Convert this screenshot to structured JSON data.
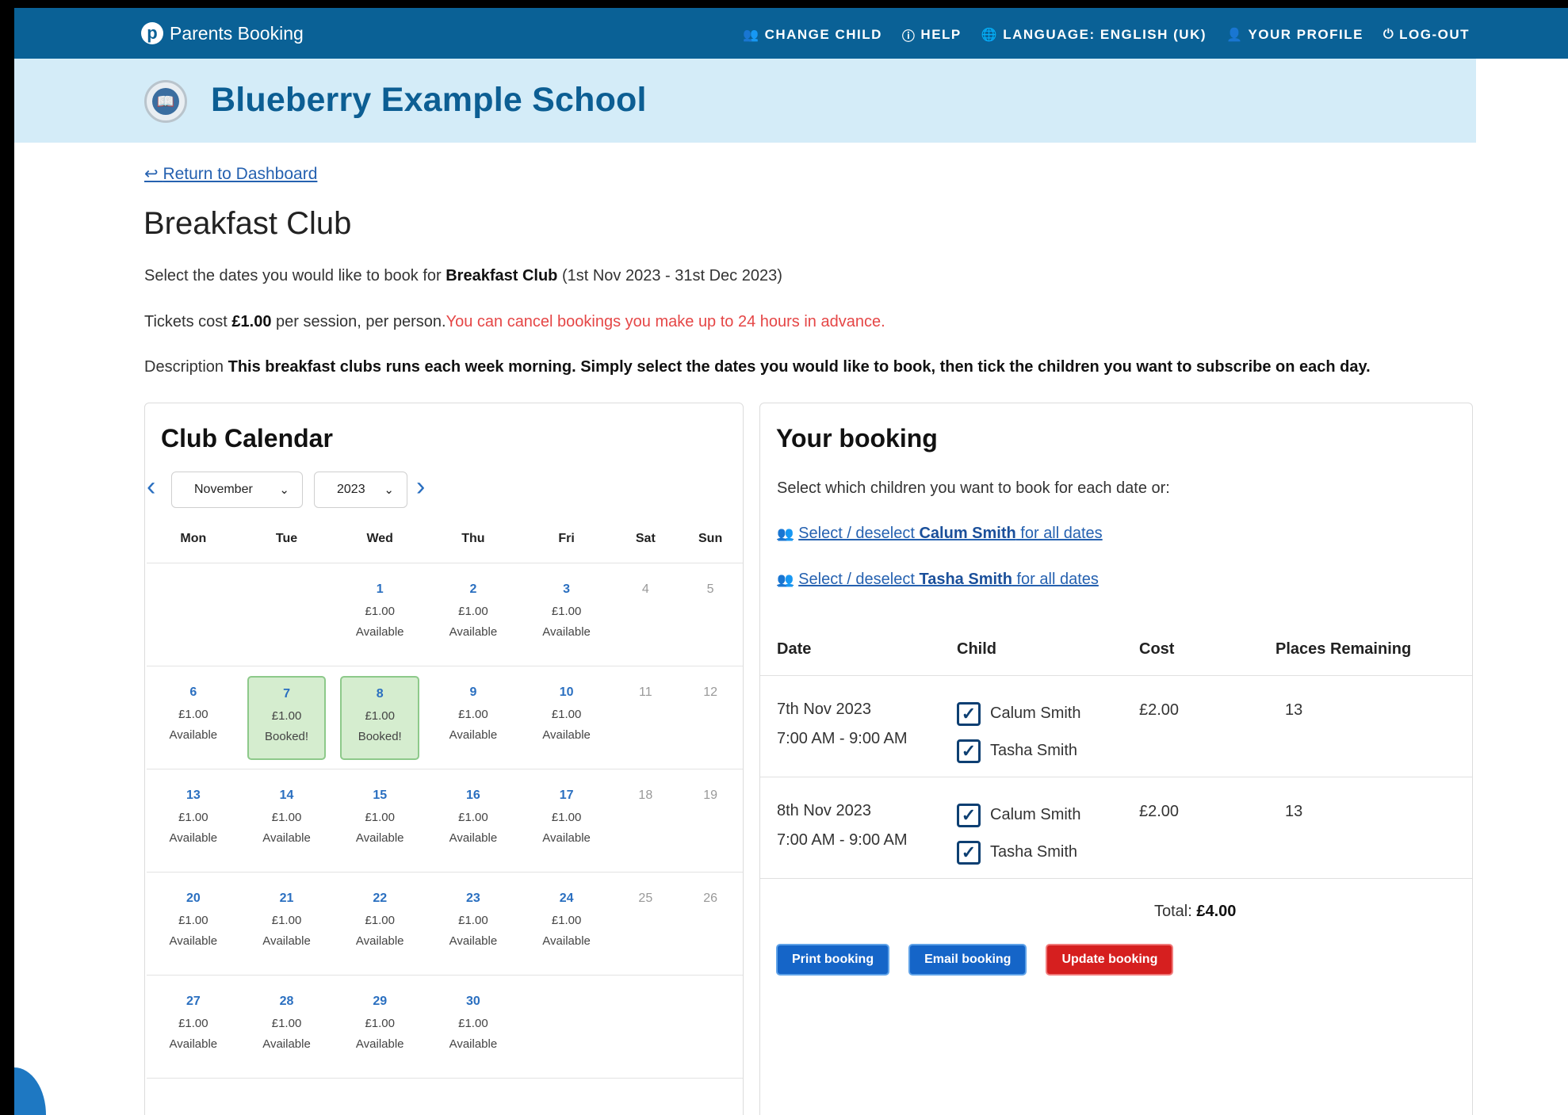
{
  "app": {
    "brand_logo": "p",
    "brand_name": "Parents Booking",
    "accent": "#0a6196",
    "banner_bg": "#d4ecf8"
  },
  "topnav": [
    {
      "label": "CHANGE CHILD",
      "icon": "people-icon"
    },
    {
      "label": "HELP",
      "icon": "help-icon"
    },
    {
      "label": "LANGUAGE: ENGLISH (UK)",
      "icon": "globe-icon"
    },
    {
      "label": "YOUR PROFILE",
      "icon": "user-icon"
    },
    {
      "label": "LOG-OUT",
      "icon": "power-icon"
    }
  ],
  "school": {
    "name": "Blueberry Example School"
  },
  "page": {
    "return_link": "Return to Dashboard",
    "title": "Breakfast Club",
    "intro_prefix": "Select the dates you would like to book for ",
    "intro_club": "Breakfast Club",
    "intro_range": " (1st Nov 2023 - 31st Dec 2023)",
    "tickets_prefix": "Tickets cost ",
    "tickets_price": "£1.00",
    "tickets_suffix": " per session, per person.",
    "cancel_notice": "You can cancel bookings you make up to 24 hours in advance.",
    "description_label": "Description ",
    "description_text": "This breakfast clubs runs each week morning. Simply select the dates you would like to book, then tick the children you want to subscribe on each day."
  },
  "calendar": {
    "title": "Club Calendar",
    "month": "November",
    "year": "2023",
    "weekdays": [
      "Mon",
      "Tue",
      "Wed",
      "Thu",
      "Fri",
      "Sat",
      "Sun"
    ],
    "weeks": [
      [
        null,
        null,
        {
          "num": "1",
          "price": "£1.00",
          "status": "Available"
        },
        {
          "num": "2",
          "price": "£1.00",
          "status": "Available"
        },
        {
          "num": "3",
          "price": "£1.00",
          "status": "Available"
        },
        {
          "num": "4",
          "weekend": true
        },
        {
          "num": "5",
          "weekend": true
        }
      ],
      [
        {
          "num": "6",
          "price": "£1.00",
          "status": "Available"
        },
        {
          "num": "7",
          "price": "£1.00",
          "status": "Booked!",
          "booked": true
        },
        {
          "num": "8",
          "price": "£1.00",
          "status": "Booked!",
          "booked": true
        },
        {
          "num": "9",
          "price": "£1.00",
          "status": "Available"
        },
        {
          "num": "10",
          "price": "£1.00",
          "status": "Available"
        },
        {
          "num": "11",
          "weekend": true
        },
        {
          "num": "12",
          "weekend": true
        }
      ],
      [
        {
          "num": "13",
          "price": "£1.00",
          "status": "Available"
        },
        {
          "num": "14",
          "price": "£1.00",
          "status": "Available"
        },
        {
          "num": "15",
          "price": "£1.00",
          "status": "Available"
        },
        {
          "num": "16",
          "price": "£1.00",
          "status": "Available"
        },
        {
          "num": "17",
          "price": "£1.00",
          "status": "Available"
        },
        {
          "num": "18",
          "weekend": true
        },
        {
          "num": "19",
          "weekend": true
        }
      ],
      [
        {
          "num": "20",
          "price": "£1.00",
          "status": "Available"
        },
        {
          "num": "21",
          "price": "£1.00",
          "status": "Available"
        },
        {
          "num": "22",
          "price": "£1.00",
          "status": "Available"
        },
        {
          "num": "23",
          "price": "£1.00",
          "status": "Available"
        },
        {
          "num": "24",
          "price": "£1.00",
          "status": "Available"
        },
        {
          "num": "25",
          "weekend": true
        },
        {
          "num": "26",
          "weekend": true
        }
      ],
      [
        {
          "num": "27",
          "price": "£1.00",
          "status": "Available"
        },
        {
          "num": "28",
          "price": "£1.00",
          "status": "Available"
        },
        {
          "num": "29",
          "price": "£1.00",
          "status": "Available"
        },
        {
          "num": "30",
          "price": "£1.00",
          "status": "Available"
        },
        null,
        null,
        null
      ]
    ]
  },
  "booking": {
    "title": "Your booking",
    "instructions": "Select which children you want to book for each date or:",
    "select_all": [
      {
        "prefix": "Select / deselect ",
        "child": "Calum Smith",
        "suffix": " for all dates"
      },
      {
        "prefix": "Select / deselect ",
        "child": "Tasha Smith",
        "suffix": " for all dates"
      }
    ],
    "columns": {
      "date": "Date",
      "child": "Child",
      "cost": "Cost",
      "places": "Places Remaining"
    },
    "rows": [
      {
        "date": "7th Nov 2023",
        "time": "7:00 AM - 9:00 AM",
        "children": [
          {
            "name": "Calum Smith",
            "checked": true
          },
          {
            "name": "Tasha Smith",
            "checked": true
          }
        ],
        "cost": "£2.00",
        "places": "13"
      },
      {
        "date": "8th Nov 2023",
        "time": "7:00 AM - 9:00 AM",
        "children": [
          {
            "name": "Calum Smith",
            "checked": true
          },
          {
            "name": "Tasha Smith",
            "checked": true
          }
        ],
        "cost": "£2.00",
        "places": "13"
      }
    ],
    "total_label": "Total: ",
    "total_value": "£4.00",
    "buttons": {
      "print": "Print booking",
      "email": "Email booking",
      "update": "Update booking"
    }
  }
}
